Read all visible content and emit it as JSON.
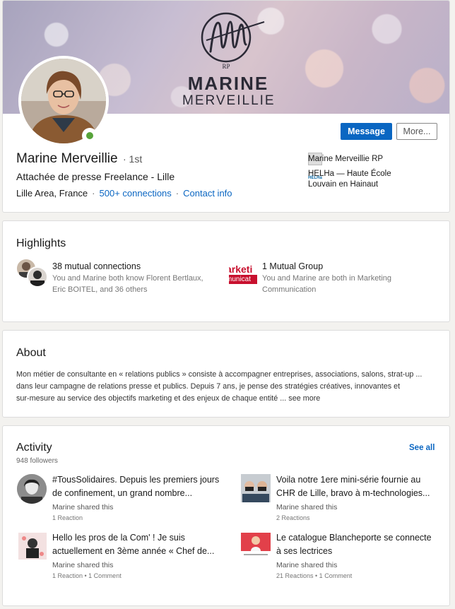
{
  "profile": {
    "banner_logo_top": "MARINE",
    "banner_logo_bottom": "MERVEILLIE",
    "name": "Marine Merveillie",
    "degree": "· 1st",
    "headline": "Attachée de presse Freelance - Lille",
    "location": "Lille Area, France",
    "connections": "500+ connections",
    "contact_info": "Contact info",
    "message_button": "Message",
    "more_button": "More...",
    "experience_company": "Marine Merveillie RP",
    "education_line1": "HELHa — Haute École",
    "education_line2": "Louvain en Hainaut",
    "education_logo_text": "HELHa"
  },
  "highlights": {
    "title": "Highlights",
    "mutual_connections_title": "38 mutual connections",
    "mutual_connections_line1": "You and Marine both know Florent Bertlaux,",
    "mutual_connections_line2": "Eric BOITEL, and 36 others",
    "group_logo_top": "arketi",
    "group_logo_bottom": "municat",
    "mutual_group_title": "1 Mutual Group",
    "mutual_group_line1": "You and Marine are both in Marketing",
    "mutual_group_line2": "Communication"
  },
  "about": {
    "title": "About",
    "line1": "Mon métier de consultante en « relations publics » consiste à accompagner entreprises, associations, salons, strat-up ...",
    "line2": "dans leur campagne de relations presse et publics. Depuis 7 ans, je pense des stratégies créatives, innovantes et",
    "line3": "sur-mesure au service des objectifs marketing et des enjeux de chaque entité ...",
    "see_more": "see more"
  },
  "activity": {
    "title": "Activity",
    "followers": "948 followers",
    "see_all": "See all",
    "posts": [
      {
        "line1": "#TousSolidaires. Depuis les premiers jours",
        "line2": "de confinement, un grand nombre...",
        "meta": "Marine shared this",
        "stats": "1 Reaction"
      },
      {
        "line1": "Voila notre 1ere mini-série fournie au",
        "line2": "CHR de Lille, bravo à m-technologies...",
        "meta": "Marine shared this",
        "stats": "2 Reactions"
      },
      {
        "line1": "Hello les pros de la Com' ! Je suis",
        "line2": "actuellement en 3ème année « Chef de...",
        "meta": "Marine shared this",
        "stats": "1 Reaction • 1 Comment"
      },
      {
        "line1": "Le catalogue Blancheporte se connecte",
        "line2": "à ses lectrices",
        "meta": "Marine shared this",
        "stats": "21 Reactions • 1 Comment"
      }
    ]
  },
  "colors": {
    "accent": "#0a66c2",
    "online": "#57a33a",
    "background": "#f3f2ef"
  }
}
